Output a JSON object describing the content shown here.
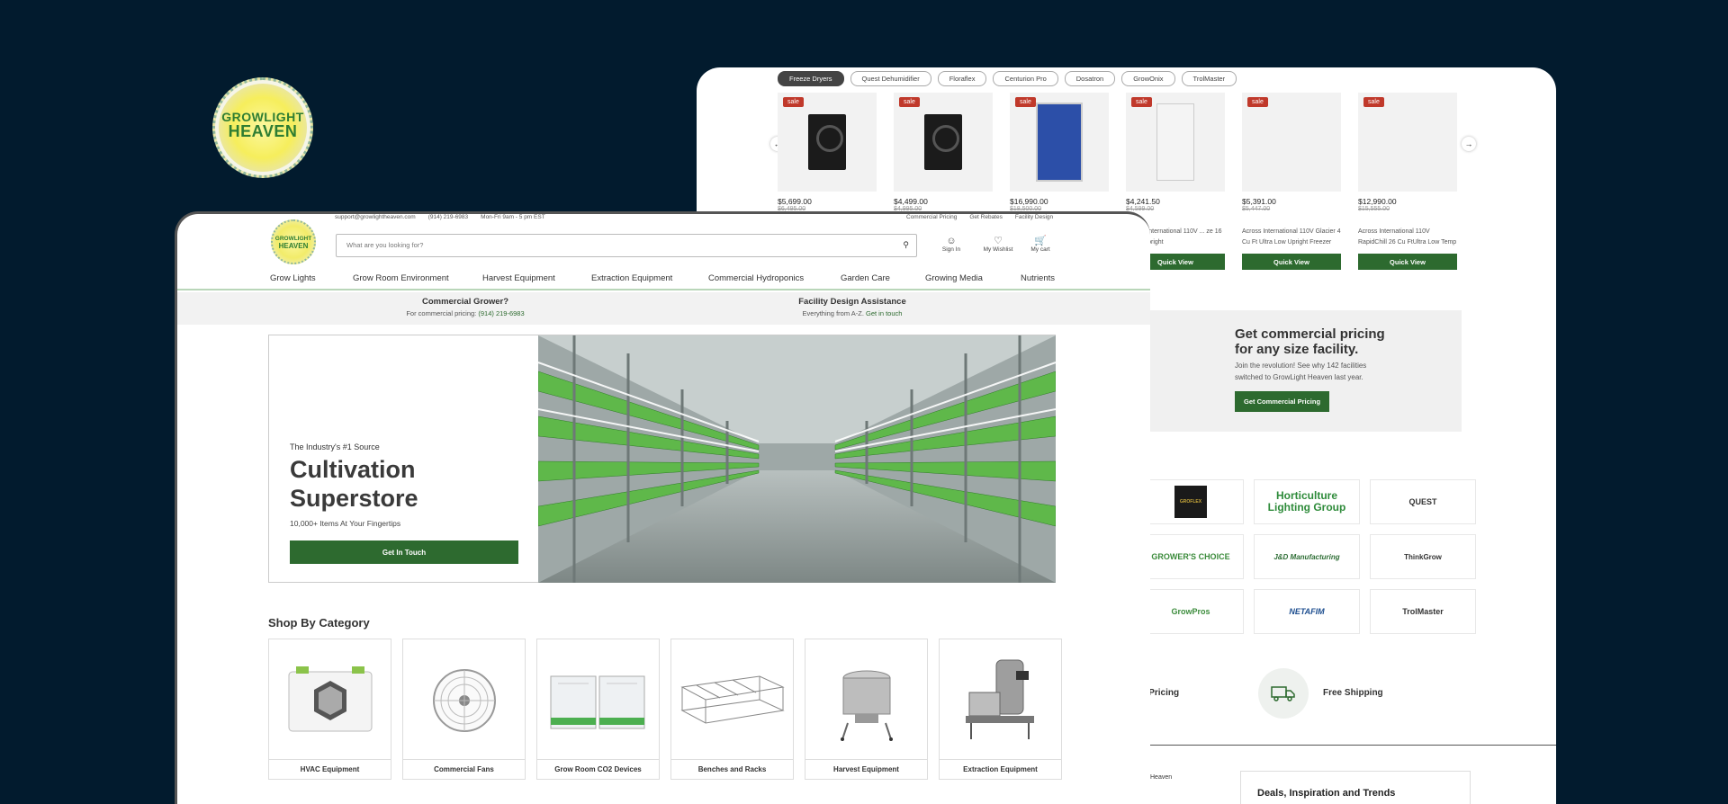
{
  "logo": {
    "line1": "GROWLIGHT",
    "line2": "HEAVEN"
  },
  "back": {
    "chips": [
      "Freeze Dryers",
      "Quest Dehumidifier",
      "Floraflex",
      "Centurion Pro",
      "Dosatron",
      "GrowOnix",
      "TrolMaster"
    ],
    "products": [
      {
        "sale": "sale",
        "price": "$5,699.00",
        "old": "$6,495.00",
        "name": "",
        "btn": ""
      },
      {
        "sale": "sale",
        "price": "$4,499.00",
        "old": "$4,995.00",
        "name": "",
        "btn": ""
      },
      {
        "sale": "sale",
        "price": "$16,990.00",
        "old": "$18,500.00",
        "name": "",
        "btn": ""
      },
      {
        "sale": "sale",
        "price": "$4,241.50",
        "old": "$4,599.00",
        "name": "Across International 110V ... ze 16 Cu Ft Upright",
        "btn": "Quick View"
      },
      {
        "sale": "sale",
        "price": "$5,391.00",
        "old": "$5,447.00",
        "name": "Across International 110V Glacier 4 Cu Ft Ultra Low Upright Freezer",
        "btn": "Quick View"
      },
      {
        "sale": "sale",
        "price": "$12,990.00",
        "old": "$15,555.00",
        "name": "Across International 110V RapidChill 26 Cu FtUltra Low Temp",
        "btn": "Quick View"
      }
    ],
    "cta": {
      "title_1": "Get commercial pricing",
      "title_2": "for any size facility.",
      "text": "Join the revolution! See why 142 facilities switched to GrowLight Heaven last year.",
      "button": "Get Commercial Pricing"
    },
    "brands": [
      "GROFLEX",
      "Horticulture Lighting Group",
      "QUEST",
      "GROWER'S CHOICE",
      "J&D Manufacturing",
      "ThinkGrow",
      "GrowPros",
      "NETAFIM",
      "TrolMaster"
    ],
    "features": {
      "pricing": "nt Pricing",
      "shipping": "Free Shipping"
    },
    "footer": {
      "heaven": "Heaven",
      "deals": "Deals, Inspiration and Trends"
    }
  },
  "front": {
    "topbar": {
      "email": "support@growlightheaven.com",
      "phone": "(914) 219-6983",
      "hours": "Mon-Fri 9am - 5 pm EST"
    },
    "topbar_right": [
      "Commercial Pricing",
      "Get Rebates",
      "Facility Design"
    ],
    "search_placeholder": "What are you looking for?",
    "icons": {
      "signin": "Sign In",
      "wishlist": "My Wishlist",
      "cart": "My cart"
    },
    "nav": [
      "Grow Lights",
      "Grow Room Environment",
      "Harvest Equipment",
      "Extraction Equipment",
      "Commercial Hydroponics",
      "Garden Care",
      "Growing Media",
      "Nutrients"
    ],
    "info": {
      "grower_title": "Commercial Grower?",
      "grower_text": "For commercial pricing: ",
      "grower_link": "(914) 219-6983",
      "design_title": "Facility Design Assistance",
      "design_text": "Everything from A-Z. ",
      "design_link": "Get in touch"
    },
    "hero": {
      "sub": "The Industry's #1 Source",
      "title_1": "Cultivation",
      "title_2": "Superstore",
      "lead": "10,000+ Items At Your Fingertips",
      "button": "Get In Touch"
    },
    "shop_title": "Shop By Category",
    "categories": [
      "HVAC Equipment",
      "Commercial Fans",
      "Grow Room CO2 Devices",
      "Benches and Racks",
      "Harvest Equipment",
      "Extraction Equipment"
    ]
  },
  "colors": {
    "bg": "#021b2e",
    "green": "#2d6a2f",
    "sale": "#c0392b"
  }
}
